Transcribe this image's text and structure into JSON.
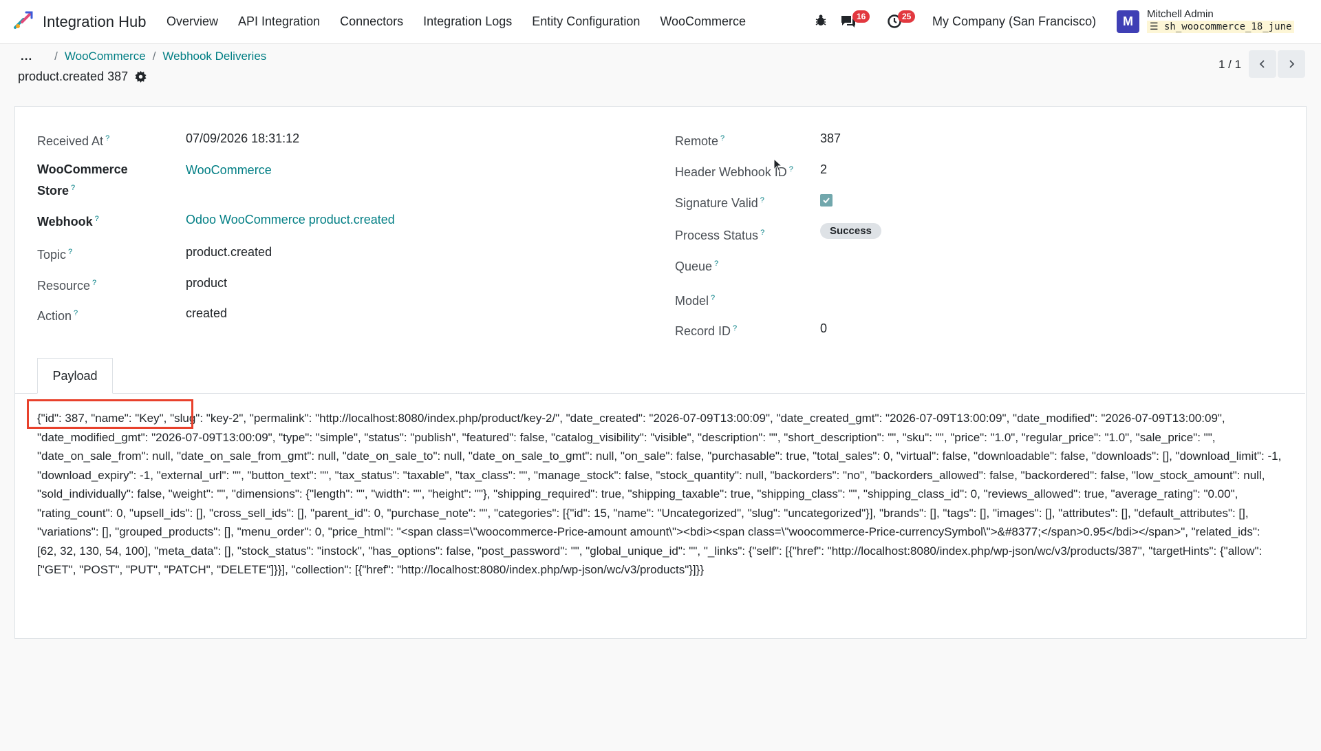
{
  "navbar": {
    "app_name": "Integration Hub",
    "menu": [
      "Overview",
      "API Integration",
      "Connectors",
      "Integration Logs",
      "Entity Configuration",
      "WooCommerce"
    ],
    "messages_badge": "16",
    "activity_badge": "25",
    "company": "My Company (San Francisco)",
    "avatar_letter": "M",
    "user_name": "Mitchell Admin",
    "user_db": "sh_woocommerce_18_june",
    "icons": [
      "bug-icon",
      "chat-icon",
      "clock-icon"
    ]
  },
  "breadcrumb": {
    "more": "...",
    "items": [
      "WooCommerce",
      "Webhook Deliveries"
    ]
  },
  "record": {
    "title": "product.created 387"
  },
  "pager": {
    "value": "1 / 1"
  },
  "fields_left": [
    {
      "label": "Received At",
      "value": "07/09/2026 18:31:12"
    },
    {
      "label": "WooCommerce Store",
      "value": "WooCommerce"
    },
    {
      "label": "Webhook",
      "value": "Odoo WooCommerce product.created"
    },
    {
      "label": "Topic",
      "value": "product.created"
    },
    {
      "label": "Resource",
      "value": "product"
    },
    {
      "label": "Action",
      "value": "created"
    }
  ],
  "fields_right": [
    {
      "label": "Remote",
      "value": "387"
    },
    {
      "label": "Header Webhook ID",
      "value": "2"
    },
    {
      "label": "Signature Valid",
      "value": ""
    },
    {
      "label": "Process Status",
      "value": "Success"
    },
    {
      "label": "Queue",
      "value": ""
    },
    {
      "label": "Model",
      "value": ""
    },
    {
      "label": "Record ID",
      "value": "0"
    }
  ],
  "signature_valid": true,
  "tab": {
    "label": "Payload"
  },
  "payload": "{\"id\": 387, \"name\": \"Key\", \"slug\": \"key-2\", \"permalink\": \"http://localhost:8080/index.php/product/key-2/\", \"date_created\": \"2026-07-09T13:00:09\", \"date_created_gmt\": \"2026-07-09T13:00:09\", \"date_modified\": \"2026-07-09T13:00:09\", \"date_modified_gmt\": \"2026-07-09T13:00:09\", \"type\": \"simple\", \"status\": \"publish\", \"featured\": false, \"catalog_visibility\": \"visible\", \"description\": \"\", \"short_description\": \"\", \"sku\": \"\", \"price\": \"1.0\", \"regular_price\": \"1.0\", \"sale_price\": \"\", \"date_on_sale_from\": null, \"date_on_sale_from_gmt\": null, \"date_on_sale_to\": null, \"date_on_sale_to_gmt\": null, \"on_sale\": false, \"purchasable\": true, \"total_sales\": 0, \"virtual\": false, \"downloadable\": false, \"downloads\": [], \"download_limit\": -1, \"download_expiry\": -1, \"external_url\": \"\", \"button_text\": \"\", \"tax_status\": \"taxable\", \"tax_class\": \"\", \"manage_stock\": false, \"stock_quantity\": null, \"backorders\": \"no\", \"backorders_allowed\": false, \"backordered\": false, \"low_stock_amount\": null, \"sold_individually\": false, \"weight\": \"\", \"dimensions\": {\"length\": \"\", \"width\": \"\", \"height\": \"\"}, \"shipping_required\": true, \"shipping_taxable\": true, \"shipping_class\": \"\", \"shipping_class_id\": 0, \"reviews_allowed\": true, \"average_rating\": \"0.00\", \"rating_count\": 0, \"upsell_ids\": [], \"cross_sell_ids\": [], \"parent_id\": 0, \"purchase_note\": \"\", \"categories\": [{\"id\": 15, \"name\": \"Uncategorized\", \"slug\": \"uncategorized\"}], \"brands\": [], \"tags\": [], \"images\": [], \"attributes\": [], \"default_attributes\": [], \"variations\": [], \"grouped_products\": [], \"menu_order\": 0, \"price_html\": \"<span class=\\\"woocommerce-Price-amount amount\\\"><bdi><span class=\\\"woocommerce-Price-currencySymbol\\\">&#8377;</span>0.95</bdi></span>\", \"related_ids\": [62, 32, 130, 54, 100], \"meta_data\": [], \"stock_status\": \"instock\", \"has_options\": false, \"post_password\": \"\", \"global_unique_id\": \"\", \"_links\": {\"self\": [{\"href\": \"http://localhost:8080/index.php/wp-json/wc/v3/products/387\", \"targetHints\": {\"allow\": [\"GET\", \"POST\", \"PUT\", \"PATCH\", \"DELETE\"]}}], \"collection\": [{\"href\": \"http://localhost:8080/index.php/wp-json/wc/v3/products\"}]}}",
  "colors": {
    "accent": "#017e84",
    "badge": "#e2383f",
    "avatar": "#3f3fb5",
    "highlight": "#e8412c"
  }
}
